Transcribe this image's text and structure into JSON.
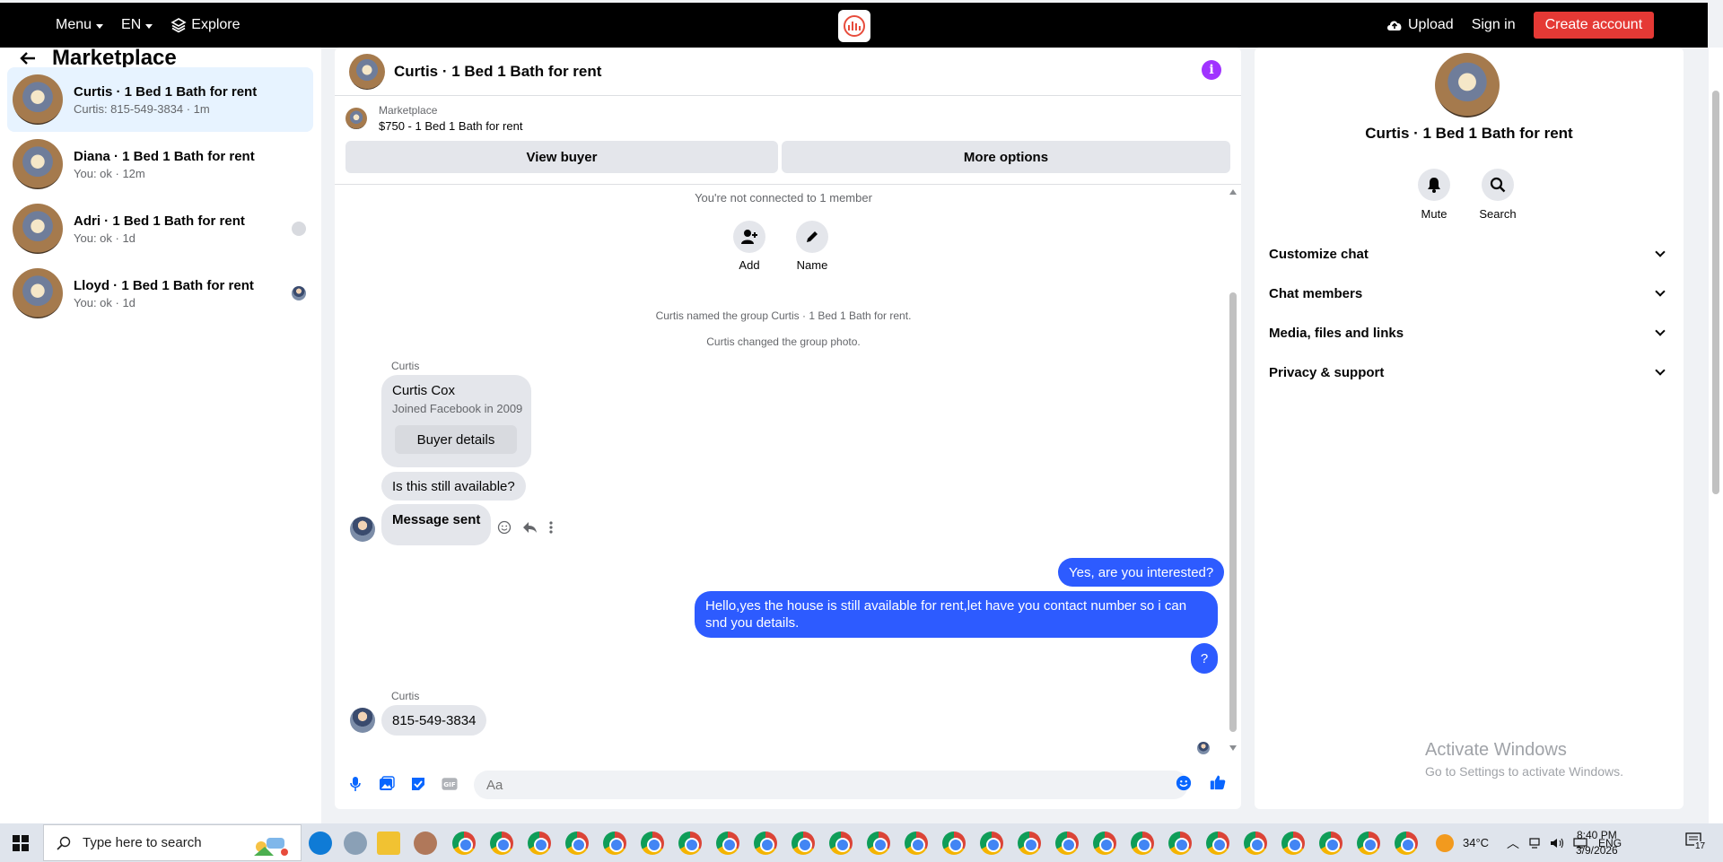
{
  "topbar": {
    "menu_label": "Menu",
    "lang_label": "EN",
    "explore_label": "Explore",
    "upload_label": "Upload",
    "signin_label": "Sign in",
    "create_label": "Create account"
  },
  "sidebar": {
    "title": "Marketplace",
    "conversations": [
      {
        "name": "Curtis · 1 Bed 1 Bath for rent",
        "sub": "Curtis: 815-549-3834 · 1m"
      },
      {
        "name": "Diana · 1 Bed 1 Bath for rent",
        "sub": "You: ok · 12m"
      },
      {
        "name": "Adri · 1 Bed 1 Bath for rent",
        "sub": "You: ok · 1d"
      },
      {
        "name": "Lloyd · 1 Bed 1 Bath for rent",
        "sub": "You: ok · 1d"
      }
    ]
  },
  "chat": {
    "title": "Curtis · 1 Bed 1 Bath for rent",
    "marketplace_label": "Marketplace",
    "listing": "$750 - 1 Bed 1 Bath for rent",
    "view_buyer": "View buyer",
    "more_options": "More options",
    "not_connected": "You're not connected to 1 member",
    "add_label": "Add",
    "name_label": "Name",
    "sys1": "Curtis named the group Curtis · 1 Bed 1 Bath for rent.",
    "sys2": "Curtis changed the group photo.",
    "sender1": "Curtis",
    "card_name": "Curtis Cox",
    "card_joined": "Joined Facebook in 2009",
    "buyer_details": "Buyer details",
    "msg_available": "Is this still available?",
    "msg_sent": "Message sent",
    "out1": "Yes, are you interested?",
    "out2": "Hello,yes the house is still available for rent,let have you contact number so i can snd you details.",
    "out3": "?",
    "sender2": "Curtis",
    "msg_number": "815-549-3834",
    "composer_placeholder": "Aa"
  },
  "rightpanel": {
    "title": "Curtis · 1 Bed 1 Bath for rent",
    "mute_label": "Mute",
    "search_label": "Search",
    "sections": [
      "Customize chat",
      "Chat members",
      "Media, files and links",
      "Privacy & support"
    ],
    "activate_title": "Activate Windows",
    "activate_sub": "Go to Settings to activate Windows."
  },
  "taskbar": {
    "search_placeholder": "Type here to search",
    "temperature": "34°C",
    "lang": "ENG",
    "time": "8:40 PM",
    "date": "3/9/2026",
    "notifications": "17"
  },
  "colors": {
    "accent_blue": "#2d5bff",
    "create_red": "#e53935",
    "info_purple": "#a033ff",
    "active_conv": "#e7f3ff"
  }
}
